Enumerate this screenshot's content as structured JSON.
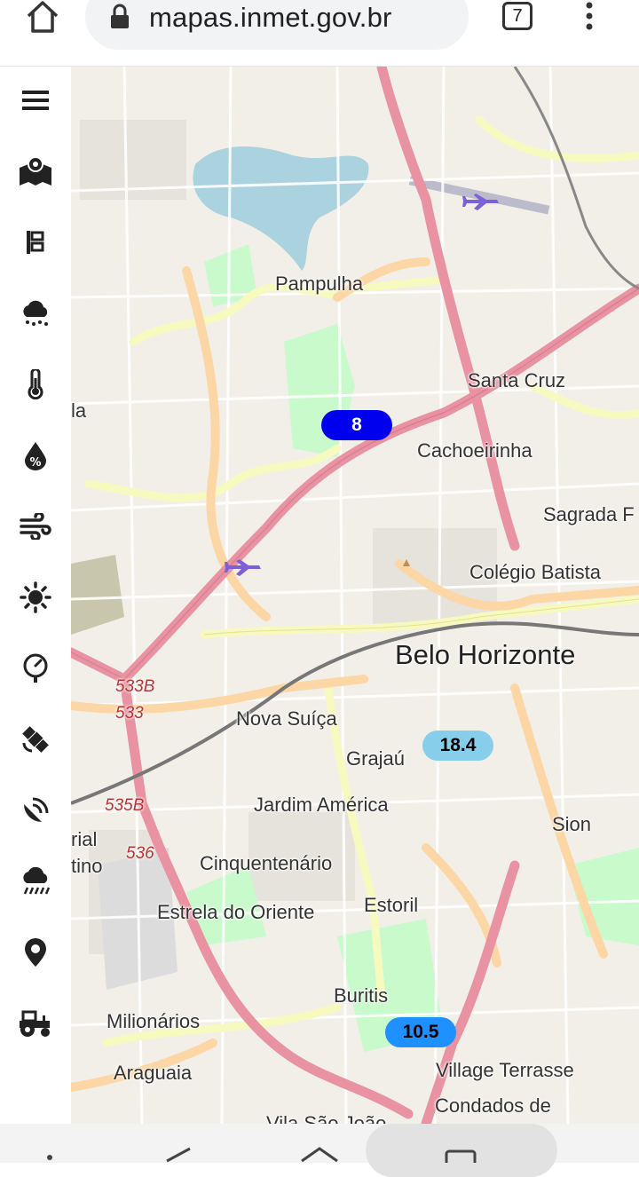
{
  "browser": {
    "url": "mapas.inmet.gov.br",
    "tab_count": "7",
    "icons": [
      "home-icon",
      "lock-icon",
      "tabs-icon",
      "more-vertical-icon"
    ]
  },
  "sidebar": {
    "items": [
      {
        "name": "menu",
        "icon": "hamburger-icon"
      },
      {
        "name": "map-layers",
        "icon": "map-pin-icon"
      },
      {
        "name": "stations",
        "icon": "station-icon"
      },
      {
        "name": "precipitation",
        "icon": "rain-cloud-icon"
      },
      {
        "name": "temperature",
        "icon": "thermometer-icon"
      },
      {
        "name": "humidity",
        "icon": "humidity-drop-icon"
      },
      {
        "name": "wind",
        "icon": "wind-icon"
      },
      {
        "name": "radiation",
        "icon": "sun-icon"
      },
      {
        "name": "pressure",
        "icon": "gauge-icon"
      },
      {
        "name": "satellite",
        "icon": "satellite-icon"
      },
      {
        "name": "radar",
        "icon": "radar-icon"
      },
      {
        "name": "storm",
        "icon": "storm-cloud-icon"
      },
      {
        "name": "location",
        "icon": "location-pin-icon"
      },
      {
        "name": "agriculture",
        "icon": "tractor-icon"
      }
    ]
  },
  "map": {
    "places": {
      "pampulha": "Pampulha",
      "santa_cruz": "Santa Cruz",
      "cachoeirinha": "Cachoeirinha",
      "sagrada": "Sagrada F",
      "colegio_batista": "Colégio Batista",
      "belo_horizonte": "Belo Horizonte",
      "nova_suica": "Nova Suíça",
      "grajau": "Grajaú",
      "jardim_america": "Jardim América",
      "sion": "Sion",
      "cinquentenario": "Cinquentenário",
      "estrela_do_oriente": "Estrela do Oriente",
      "estoril": "Estoril",
      "buritis": "Buritis",
      "milionarios": "Milionários",
      "araguaia": "Araguaia",
      "village_terrasse": "Village Terrasse",
      "condados_de": "Condados de",
      "vila_sao_joao": "Vila São João",
      "left_la": "la",
      "left_rial": "rial",
      "left_tino": "tino"
    },
    "road_refs": [
      "533B",
      "533",
      "535B",
      "536"
    ],
    "markers": [
      {
        "value": "8",
        "color": "#0000ee",
        "text_color": "#ffffff"
      },
      {
        "value": "18.4",
        "color": "#87ceeb",
        "text_color": "#000000"
      },
      {
        "value": "10.5",
        "color": "#1e90ff",
        "text_color": "#000000"
      }
    ],
    "colors": {
      "major_road": "#e892a2",
      "secondary_road": "#fcd6a4",
      "tertiary_road": "#f7fabf",
      "water": "#aad3df",
      "park": "#c8facc",
      "airport_icon": "#7b60d8"
    }
  },
  "navbar": {
    "icons": [
      "recent-apps-icon",
      "back-icon",
      "home-nav-icon",
      "overview-icon"
    ]
  }
}
